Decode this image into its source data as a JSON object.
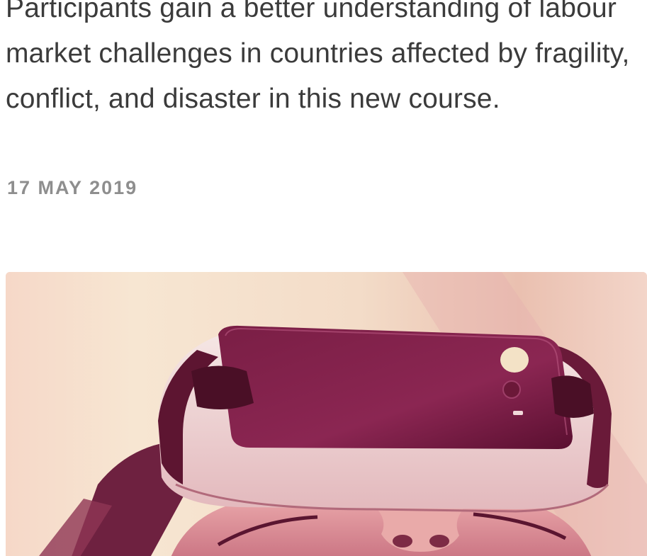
{
  "article": {
    "excerpt": "Participants gain a better understanding of labour market challenges in countries affected by fragility, conflict, and disaster in this new course.",
    "date": "17 MAY 2019"
  },
  "image": {
    "subject": "vr-headset-photo",
    "tint": "#9c2a55"
  }
}
